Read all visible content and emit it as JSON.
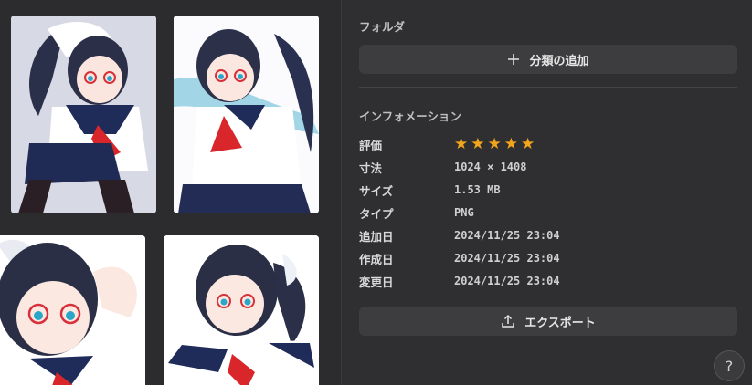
{
  "gallery": {
    "images": [
      {
        "name": "thumbnail-1"
      },
      {
        "name": "thumbnail-2"
      },
      {
        "name": "thumbnail-3"
      },
      {
        "name": "thumbnail-4"
      }
    ]
  },
  "folder": {
    "title": "フォルダ",
    "add_button_label": "分類の追加",
    "add_icon": "plus-icon"
  },
  "info": {
    "title": "インフォメーション",
    "rating_label": "評価",
    "rating": 5,
    "rating_max": 5,
    "rows": [
      {
        "label": "寸法",
        "value": "1024 × 1408"
      },
      {
        "label": "サイズ",
        "value": "1.53 MB"
      },
      {
        "label": "タイプ",
        "value": "PNG"
      },
      {
        "label": "追加日",
        "value": "2024/11/25 23:04"
      },
      {
        "label": "作成日",
        "value": "2024/11/25 23:04"
      },
      {
        "label": "変更日",
        "value": "2024/11/25 23:04"
      }
    ]
  },
  "export": {
    "label": "エクスポート",
    "icon": "upload-icon"
  },
  "help": {
    "label": "?"
  },
  "colors": {
    "star": "#f2a51c",
    "panel_bg": "#2f2f31",
    "button_bg": "#3d3d40"
  }
}
